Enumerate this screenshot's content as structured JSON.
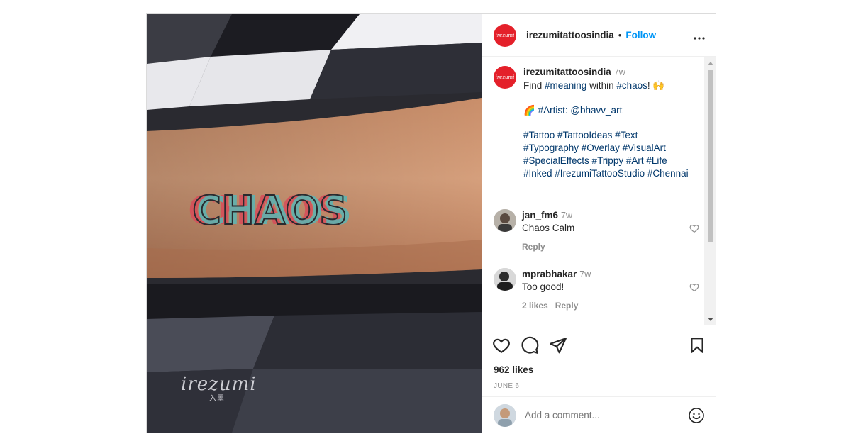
{
  "account": {
    "username": "irezumitattoosindia",
    "follow_label": "Follow",
    "separator": "•"
  },
  "photo": {
    "tattoo_text": "CHAOS",
    "watermark": "irezumi",
    "watermark_sub": "入墨"
  },
  "caption": {
    "username": "irezumitattoosindia",
    "time": "7w",
    "line1_a": "Find ",
    "line1_tag1": "#meaning",
    "line1_b": " within ",
    "line1_tag2": "#chaos",
    "line1_c": "! 🙌",
    "artist_emoji": "🌈",
    "artist_label": " #Artist: @bhavv_art",
    "tags": [
      "#Tattoo #TattooIdeas #Text",
      "#Typography #Overlay #VisualArt",
      "#SpecialEffects #Trippy #Art #Life",
      "#Inked #IrezumiTattooStudio #Chennai"
    ]
  },
  "comments": [
    {
      "username": "jan_fm6",
      "time": "7w",
      "text": "Chaos Calm",
      "likes": "",
      "reply_label": "Reply"
    },
    {
      "username": "mprabhakar",
      "time": "7w",
      "text": "Too good!",
      "likes": "2 likes",
      "reply_label": "Reply"
    }
  ],
  "stats": {
    "likes": "962 likes",
    "date": "JUNE 6"
  },
  "add_comment": {
    "placeholder": "Add a comment..."
  },
  "icons": [
    "more-icon",
    "heart-icon",
    "comment-icon",
    "share-icon",
    "bookmark-icon",
    "emoji-icon"
  ],
  "colors": {
    "follow": "#0095f6",
    "brand": "#e4202a",
    "hashtag": "#00376b",
    "muted": "#8e8e8e"
  }
}
